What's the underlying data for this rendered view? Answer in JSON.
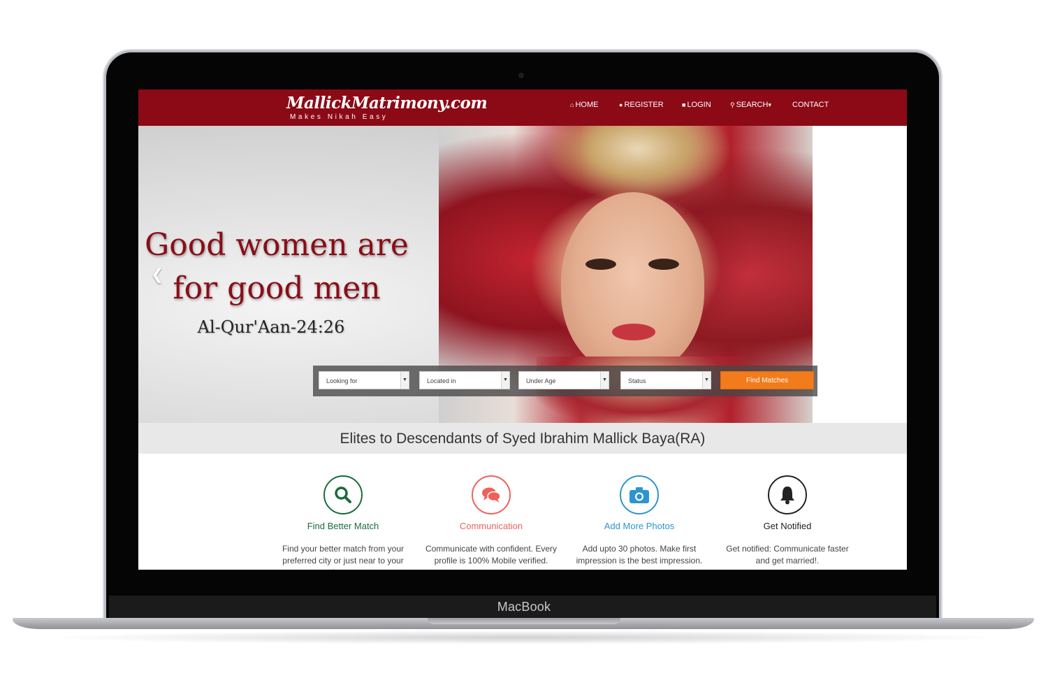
{
  "device": {
    "label": "MacBook"
  },
  "site": {
    "logo_text": "MallickMatrimony.com",
    "tagline": "Makes Nikah Easy"
  },
  "nav": {
    "home": "HOME",
    "register": "REGISTER",
    "login": "LOGIN",
    "search": "SEARCH",
    "contact": "CONTACT"
  },
  "hero": {
    "quote_line1": "Good women are",
    "quote_line2": "for good men",
    "verse": "Al-Qur'Aan-24:26"
  },
  "search_form": {
    "looking_for": "Looking for",
    "located_in": "Located in",
    "under_age": "Under Age",
    "status": "Status",
    "button": "Find Matches"
  },
  "band": {
    "text": "Elites to Descendants of Syed Ibrahim Mallick Baya(RA)"
  },
  "features": [
    {
      "title": "Find Better Match",
      "description": "Find your better match from your preferred city or just near to your home",
      "icon": "search-icon",
      "color": "#1a6b3a"
    },
    {
      "title": "Communication",
      "description": "Communicate with confident. Every profile is 100% Mobile verified.",
      "icon": "chat-icon",
      "color": "#f0605a"
    },
    {
      "title": "Add More Photos",
      "description": "Add upto 30 photos. Make first impression is the best impression.",
      "icon": "camera-icon",
      "color": "#2d95cf"
    },
    {
      "title": "Get Notified",
      "description": "Get notified: Communicate faster and get married!.",
      "icon": "bell-icon",
      "color": "#222222"
    }
  ],
  "colors": {
    "brand": "#8b0a16",
    "accent": "#f27b1c"
  }
}
